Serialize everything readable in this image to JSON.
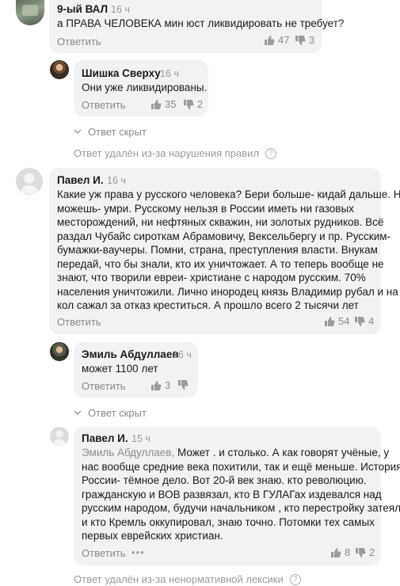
{
  "comments": [
    {
      "author": "9-ый ВАЛ",
      "time": "16 ч",
      "text": "а ПРАВА ЧЕЛОВЕКА мин юст ликвидировать не требует?",
      "reply_label": "Ответить",
      "likes": "47",
      "dislikes": "3"
    },
    {
      "author": "Шишка Сверху",
      "time": "16 ч",
      "text": "Они уже ликвидированы.",
      "reply_label": "Ответить",
      "likes": "35",
      "dislikes": "2"
    },
    {
      "author": "Павел И.",
      "time": "16 ч",
      "lines": [
        "Какие уж права у русского человека? Бери больше- кидай дальше. Не",
        "можешь- умри.  Русскому нельзя в России иметь ни газовых",
        "месторождений, ни нефтяных скважин, ни золотых рудников. Всё",
        "раздал Чубайс сироткам Абрамовичу,  Вексельбергу и пр.  Русским-",
        "бумажки-ваучеры. Помни, страна, преступления власти. Внукам",
        "передай, что бы знали, кто их уничтожает. А то теперь вообще не",
        "знают, что творили евреи- христиане с народом русским.  70%",
        "населения уничтожили. Лично  инородец князь Владимир рубал и на",
        "кол сажал за отказ креститься. А прошло всего 2 тысячи лет"
      ],
      "reply_label": "Ответить",
      "likes": "54",
      "dislikes": "4"
    },
    {
      "author": "Эмиль Абдуллаев",
      "time": "16 ч",
      "text": "может 1100 лет",
      "reply_label": "Ответить",
      "likes": "3",
      "dislikes": ""
    },
    {
      "author": "Павел И.",
      "time": "15 ч",
      "mention": "Эмиль Абдуллаев,",
      "first_line_rest": " Может . и столько. А как говорят учёные, у",
      "lines": [
        "нас вообще средние века похитили, так и ещё меньше. История",
        "России- тёмное дело. Вот 20-й век знаю. кто революцию.",
        "гражданскую и ВОВ развязал, кто  В ГУЛАГах издевался над",
        "русским народом, будучи начальником , кто перестройку затеял",
        "и кто Кремль оккупировал, знаю точно. Потомки тех самых",
        "первых еврейских христиан."
      ],
      "reply_label": "Ответить",
      "more": "•••",
      "likes": "8",
      "dislikes": "2"
    }
  ],
  "thread_toggles": [
    "Ответ скрыт",
    "Ответ скрыт"
  ],
  "deleted_notices": [
    "Ответ удалён из-за нарушения правил",
    "Ответ удалён из-за ненормативной лексики"
  ],
  "help_glyph": "?",
  "colors": {
    "bubble": "#f2f2f4",
    "muted": "#8a8a90",
    "text": "#1a1a1a"
  }
}
